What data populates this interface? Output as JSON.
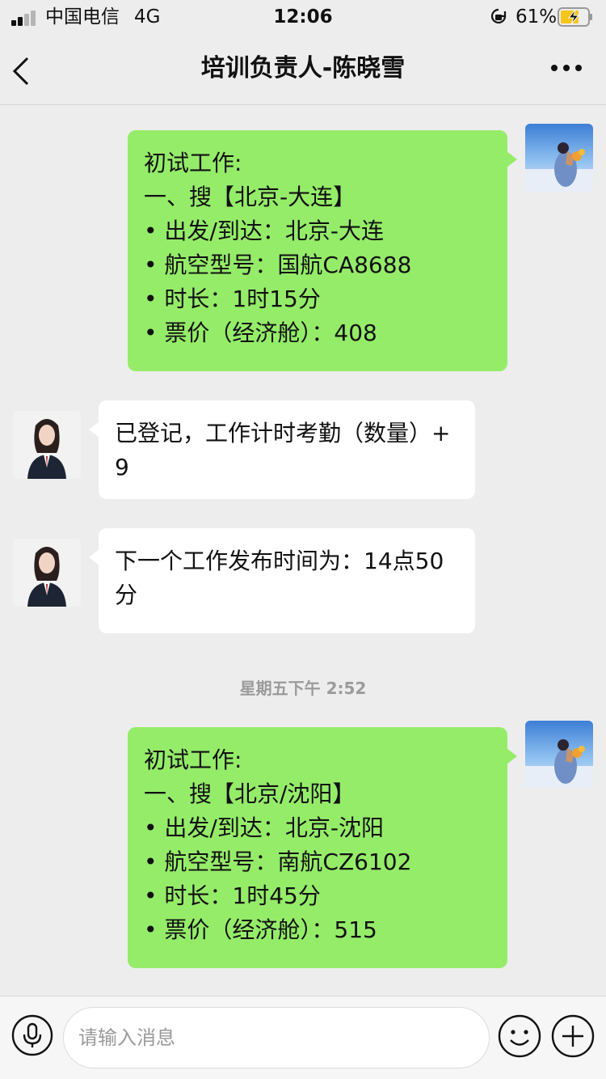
{
  "status": {
    "carrier": "中国电信",
    "network": "4G",
    "time": "12:06",
    "battery": "61%"
  },
  "nav": {
    "title": "培训负责人-陈晓雪"
  },
  "messages": {
    "m1": {
      "lines": [
        "初试工作:",
        "一、搜【北京-大连】",
        "• 出发/到达：北京-大连",
        "• 航空型号：国航CA8688",
        "• 时长：1时15分",
        "• 票价（经济舱）：408"
      ]
    },
    "m2": {
      "text": "已登记，工作计时考勤（数量）+9"
    },
    "m3": {
      "text": "下一个工作发布时间为：14点50分"
    },
    "timestamp": "星期五下午 2:52",
    "m4": {
      "lines": [
        "初试工作:",
        "一、搜【北京/沈阳】",
        "• 出发/到达：北京-沈阳",
        "• 航空型号：南航CZ6102",
        "• 时长：1时45分",
        "• 票价（经济舱）：515"
      ]
    }
  },
  "input": {
    "placeholder": "请输入消息"
  },
  "colors": {
    "sent_bubble": "#95ec69",
    "received_bubble": "#ffffff",
    "background": "#ededed"
  },
  "icons": [
    "signal-icon",
    "lock-rotation-icon",
    "battery-charging-icon",
    "back-icon",
    "more-icon",
    "voice-icon",
    "emoji-icon",
    "plus-icon"
  ]
}
